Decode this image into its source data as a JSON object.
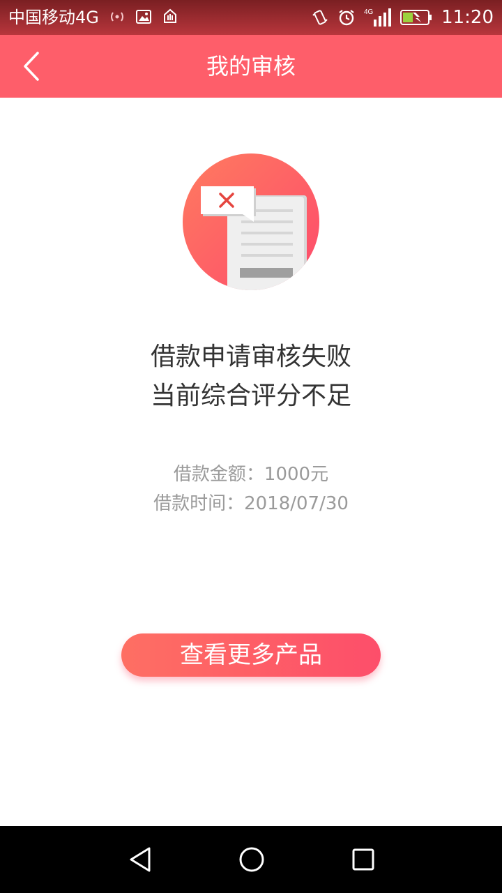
{
  "status_bar": {
    "carrier": "中国移动4G",
    "network": "4G",
    "time": "11:20",
    "icons": [
      "hotspot-icon",
      "image-icon",
      "hand-icon",
      "vibrate-icon",
      "alarm-icon",
      "signal-icon",
      "battery-charging-icon"
    ]
  },
  "app_bar": {
    "title": "我的审核",
    "back_icon": "chevron-left-icon"
  },
  "result": {
    "illustration": "rejected-document-icon",
    "line1": "借款申请审核失败",
    "line2": "当前综合评分不足"
  },
  "details": {
    "amount": "借款金额：1000元",
    "date": "借款时间：2018/07/30"
  },
  "cta": {
    "label": "查看更多产品"
  },
  "nav_bar": {
    "icons": [
      "back-triangle-icon",
      "home-circle-icon",
      "recents-square-icon"
    ]
  },
  "colors": {
    "accent": "#fe5e6a",
    "status_bar": "#a1272d",
    "text_primary": "#333333",
    "text_secondary": "#9a9a9a"
  }
}
